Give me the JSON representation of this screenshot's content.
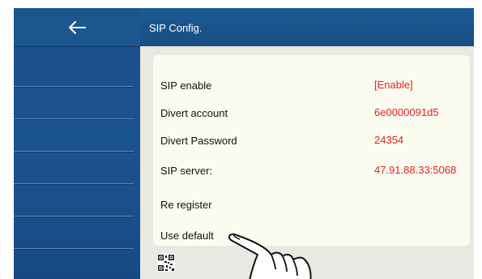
{
  "header": {
    "title": "SIP Config."
  },
  "nav": {
    "back_icon": "arrow-left-icon"
  },
  "settings": [
    {
      "label": "SIP enable",
      "value": "[Enable]"
    },
    {
      "label": "Divert account",
      "value": "6e0000091d5"
    },
    {
      "label": "Divert Password",
      "value": "24354"
    },
    {
      "label": "SIP server:",
      "value": "47.91.88.33:5068"
    },
    {
      "label": "Re register",
      "value": ""
    },
    {
      "label": "Use default",
      "value": ""
    }
  ],
  "colors": {
    "accent": "#1b568f",
    "value_text": "#ea1f1f",
    "card_bg": "#fbfbf0"
  },
  "icons": {
    "qr": "qr-code-icon",
    "pointer": "hand-pointer-icon"
  }
}
